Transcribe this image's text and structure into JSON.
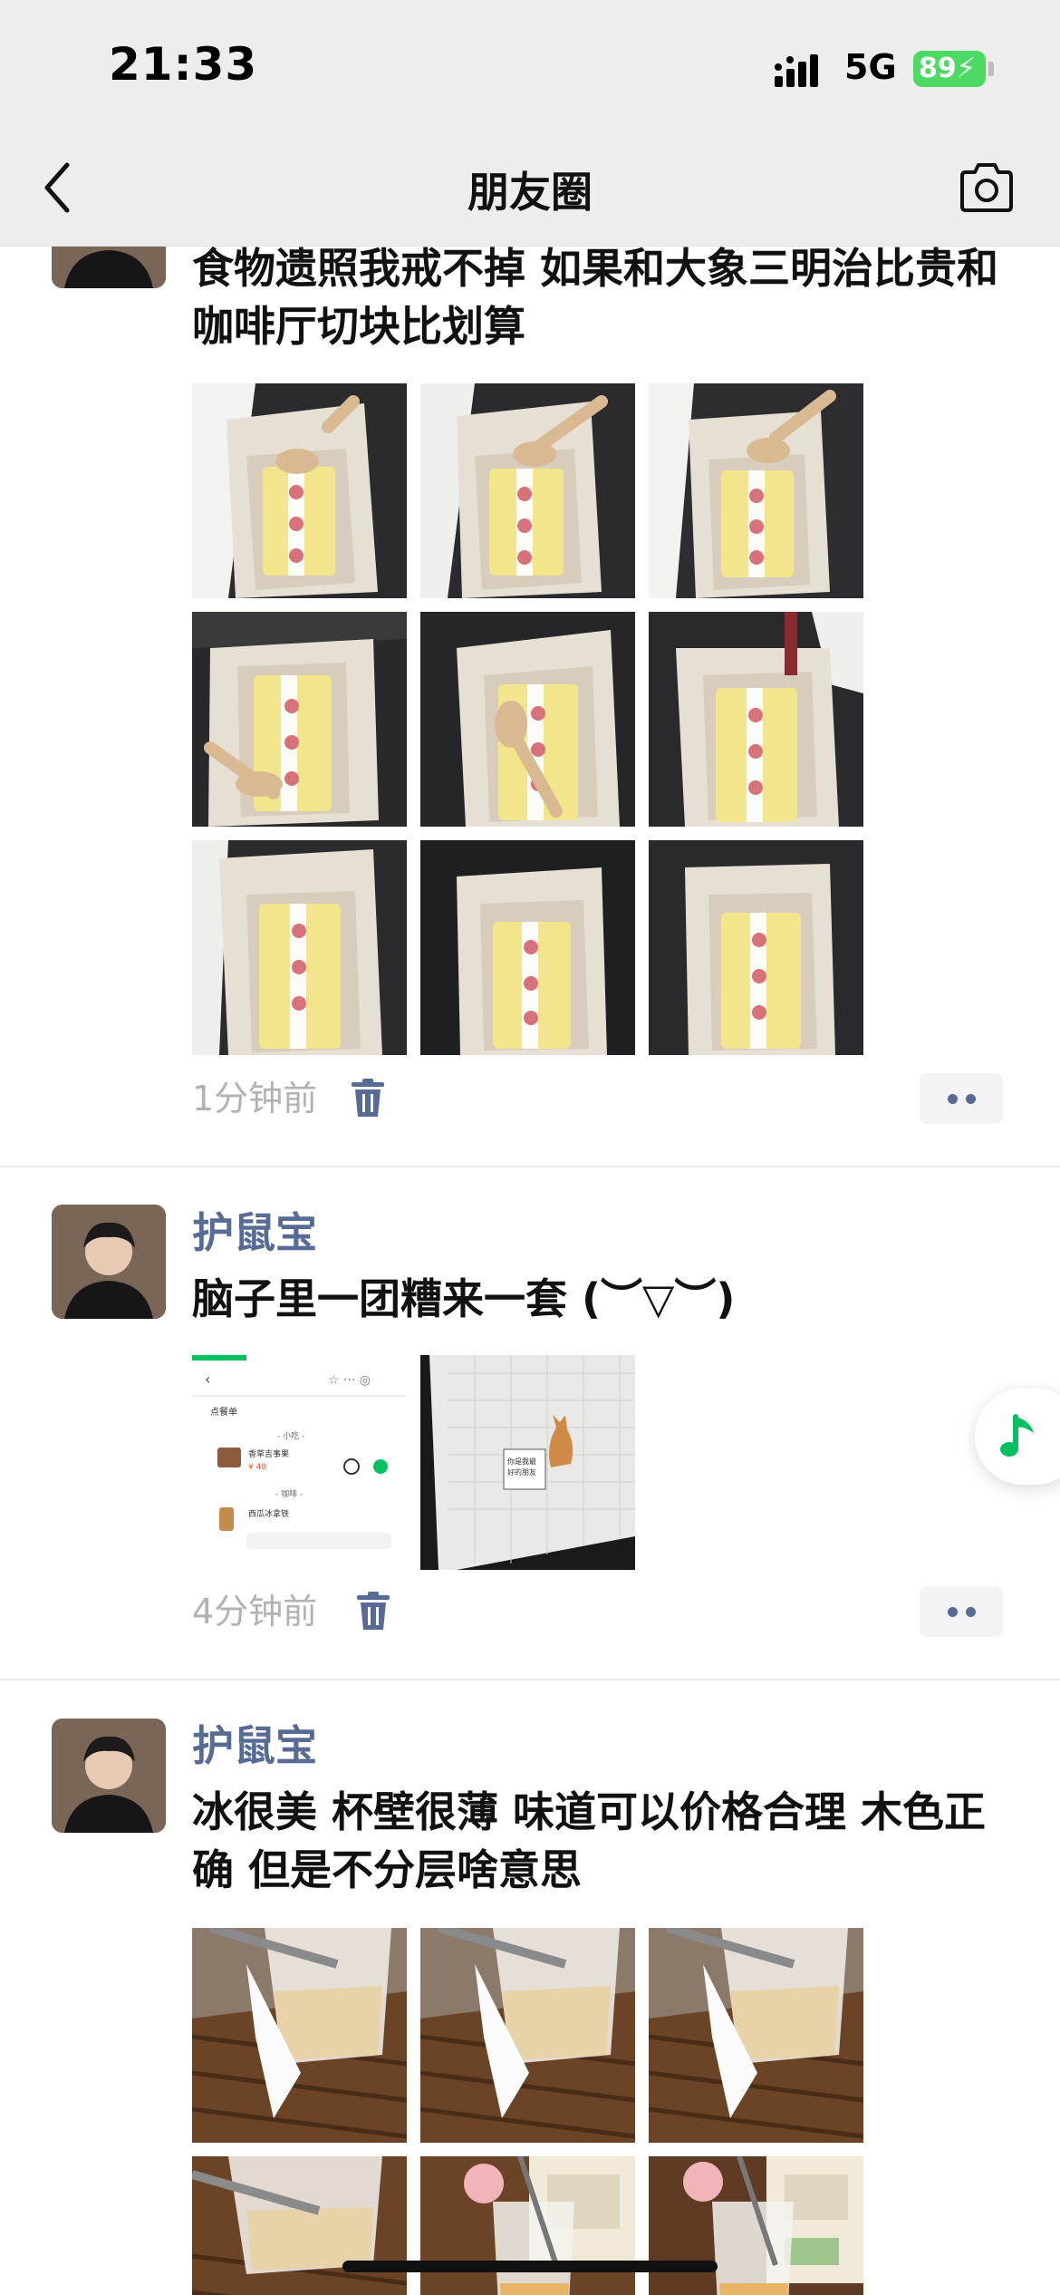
{
  "status_bar": {
    "time": "21:33",
    "network": "5G",
    "battery": "89"
  },
  "nav": {
    "title": "朋友圈"
  },
  "colors": {
    "name_blue": "#576b95",
    "battery_green": "#4cd964",
    "music_green": "#07c160"
  },
  "icons": {
    "back": "chevron-left-icon",
    "camera": "camera-icon",
    "delete": "trash-icon",
    "more": "more-dots-icon",
    "music": "music-note-icon"
  },
  "posts": [
    {
      "text": "食物遗照我戒不掉 如果和大象三明治比贵和咖啡厅切块比划算",
      "time": "1分钟前",
      "image_count": 9
    },
    {
      "name": "护鼠宝",
      "text": "脑子里一团糟来一套 (︶▽︶)",
      "time": "4分钟前",
      "image_count": 2
    },
    {
      "name": "护鼠宝",
      "text": "冰很美 杯壁很薄 味道可以价格合理 木色正确 但是不分层啥意思",
      "image_count": 6
    }
  ]
}
